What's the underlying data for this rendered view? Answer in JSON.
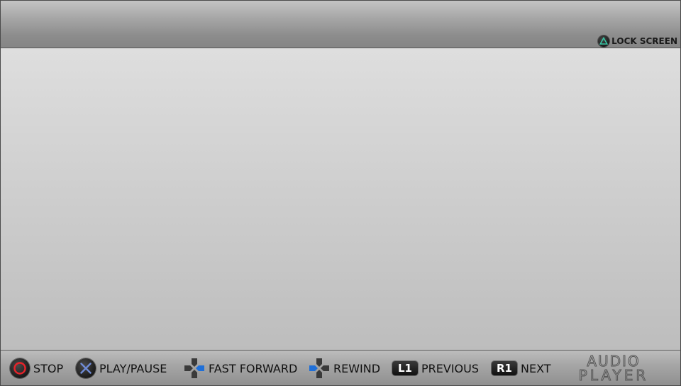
{
  "header": {
    "lock_screen": {
      "icon": "triangle-icon",
      "label": "LOCK SCREEN"
    }
  },
  "footer": {
    "controls": [
      {
        "icon": "circle-button-icon",
        "label": "STOP"
      },
      {
        "icon": "cross-button-icon",
        "label": "PLAY/PAUSE"
      },
      {
        "icon": "dpad-right-icon",
        "label": "FAST FORWARD"
      },
      {
        "icon": "dpad-left-icon",
        "label": "REWIND"
      },
      {
        "icon": "l1-button-icon",
        "button": "L1",
        "label": "PREVIOUS"
      },
      {
        "icon": "r1-button-icon",
        "button": "R1",
        "label": "NEXT"
      }
    ],
    "logo": {
      "line1": "AUDIO",
      "line2": "PLAYER"
    }
  },
  "colors": {
    "circle_symbol": "#e8232a",
    "cross_symbol": "#6f8bd6",
    "triangle_symbol": "#38c6a4",
    "dpad_active": "#1f6fd8"
  }
}
